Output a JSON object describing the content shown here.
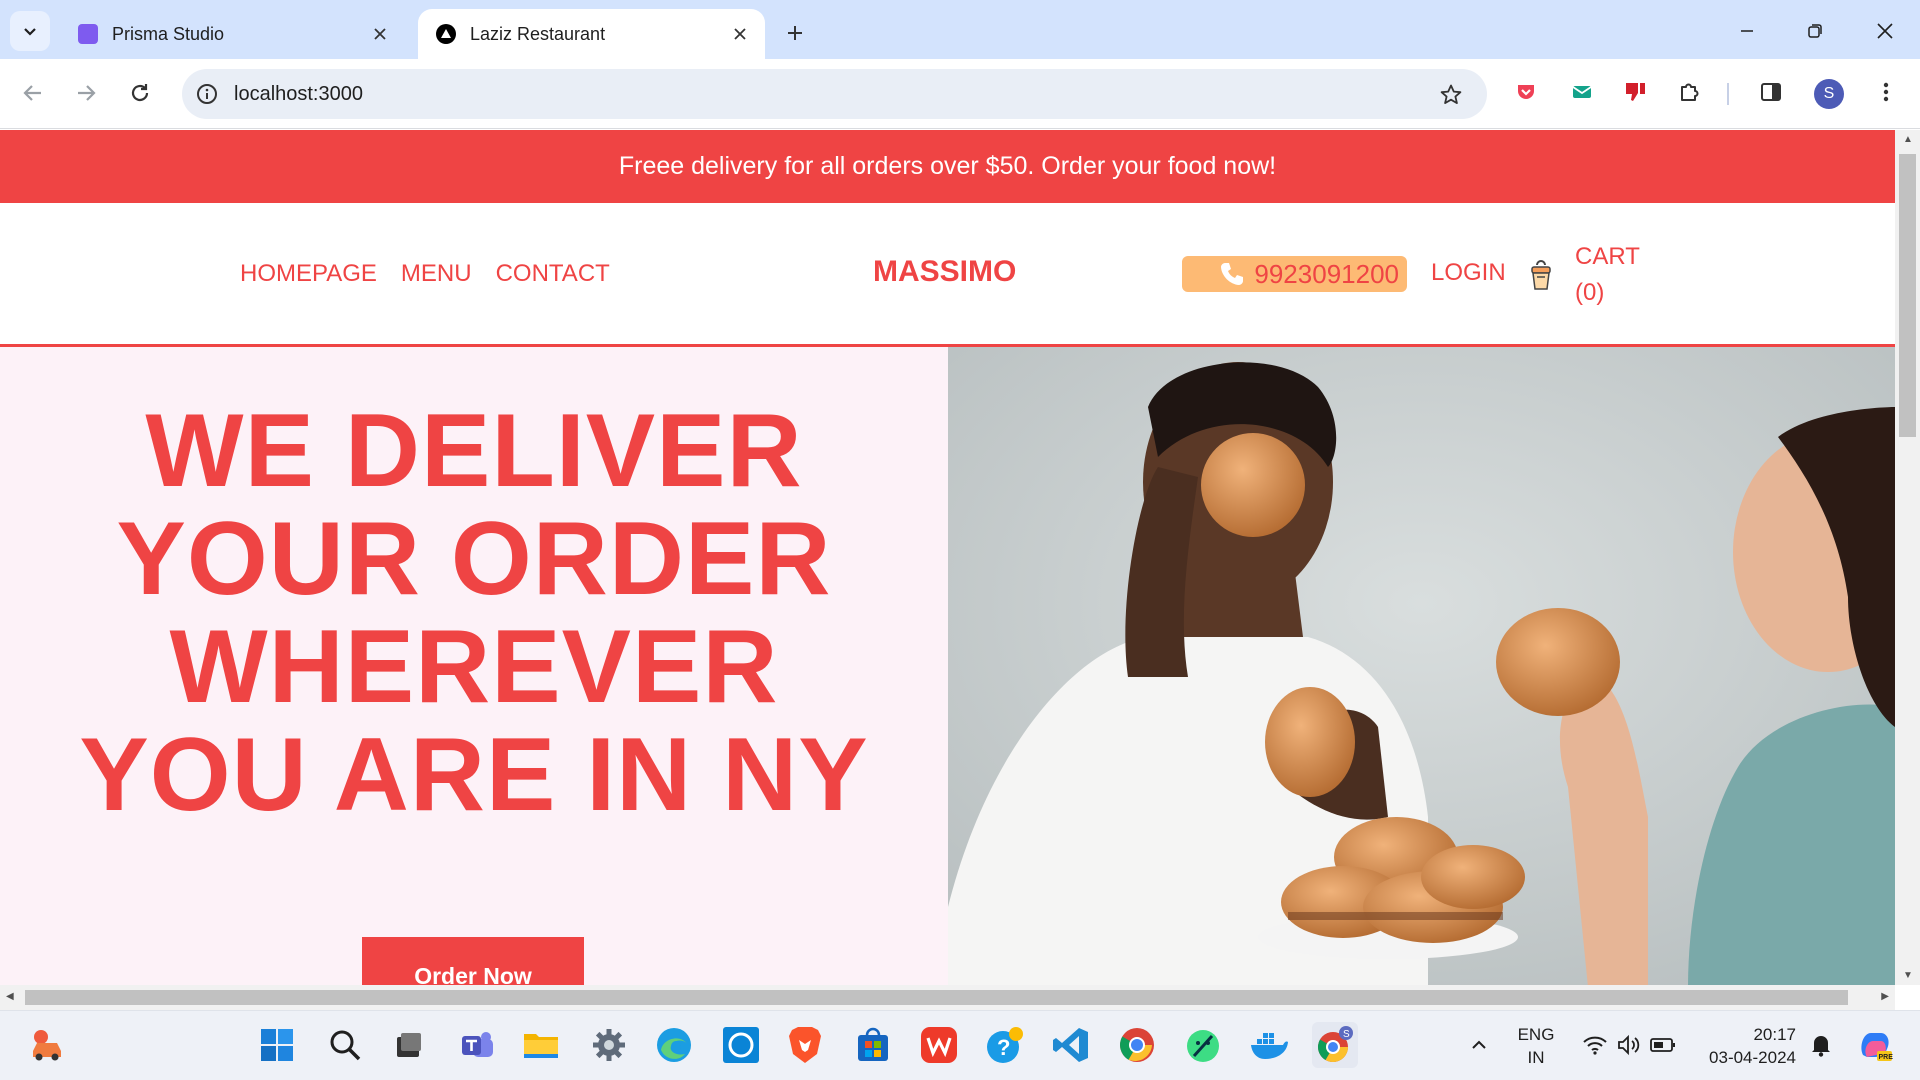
{
  "browser": {
    "tabs": [
      {
        "title": "Prisma Studio",
        "active": false
      },
      {
        "title": "Laziz Restaurant",
        "active": true
      }
    ],
    "url": "localhost:3000",
    "profile_initial": "S"
  },
  "page": {
    "promo": "Freee delivery for all orders over $50. Order your food now!",
    "nav": {
      "links": [
        "HOMEPAGE",
        "MENU",
        "CONTACT"
      ],
      "brand": "MASSIMO",
      "phone": "9923091200",
      "login": "LOGIN",
      "cart_label": "CART",
      "cart_count": "(0)"
    },
    "hero": {
      "headline_lines": [
        "WE DELIVER",
        "YOUR ORDER",
        "WHEREVER",
        "YOU ARE IN NY"
      ],
      "cta": "Order Now"
    },
    "colors": {
      "accent": "#ef4444",
      "hero_bg": "#fdf2f8",
      "phone_bg": "#fdba74"
    }
  },
  "taskbar": {
    "language": "ENG",
    "region": "IN",
    "time": "20:17",
    "date": "03-04-2024",
    "icons": [
      "start-icon",
      "search-icon",
      "task-view-icon",
      "teams-icon",
      "file-explorer-icon",
      "settings-icon",
      "edge-icon",
      "alexa-icon",
      "brave-icon",
      "microsoft-store-icon",
      "wps-office-icon",
      "help-icon",
      "vscode-icon",
      "chrome-icon",
      "android-studio-icon",
      "docker-icon",
      "chrome-profile-icon"
    ]
  }
}
